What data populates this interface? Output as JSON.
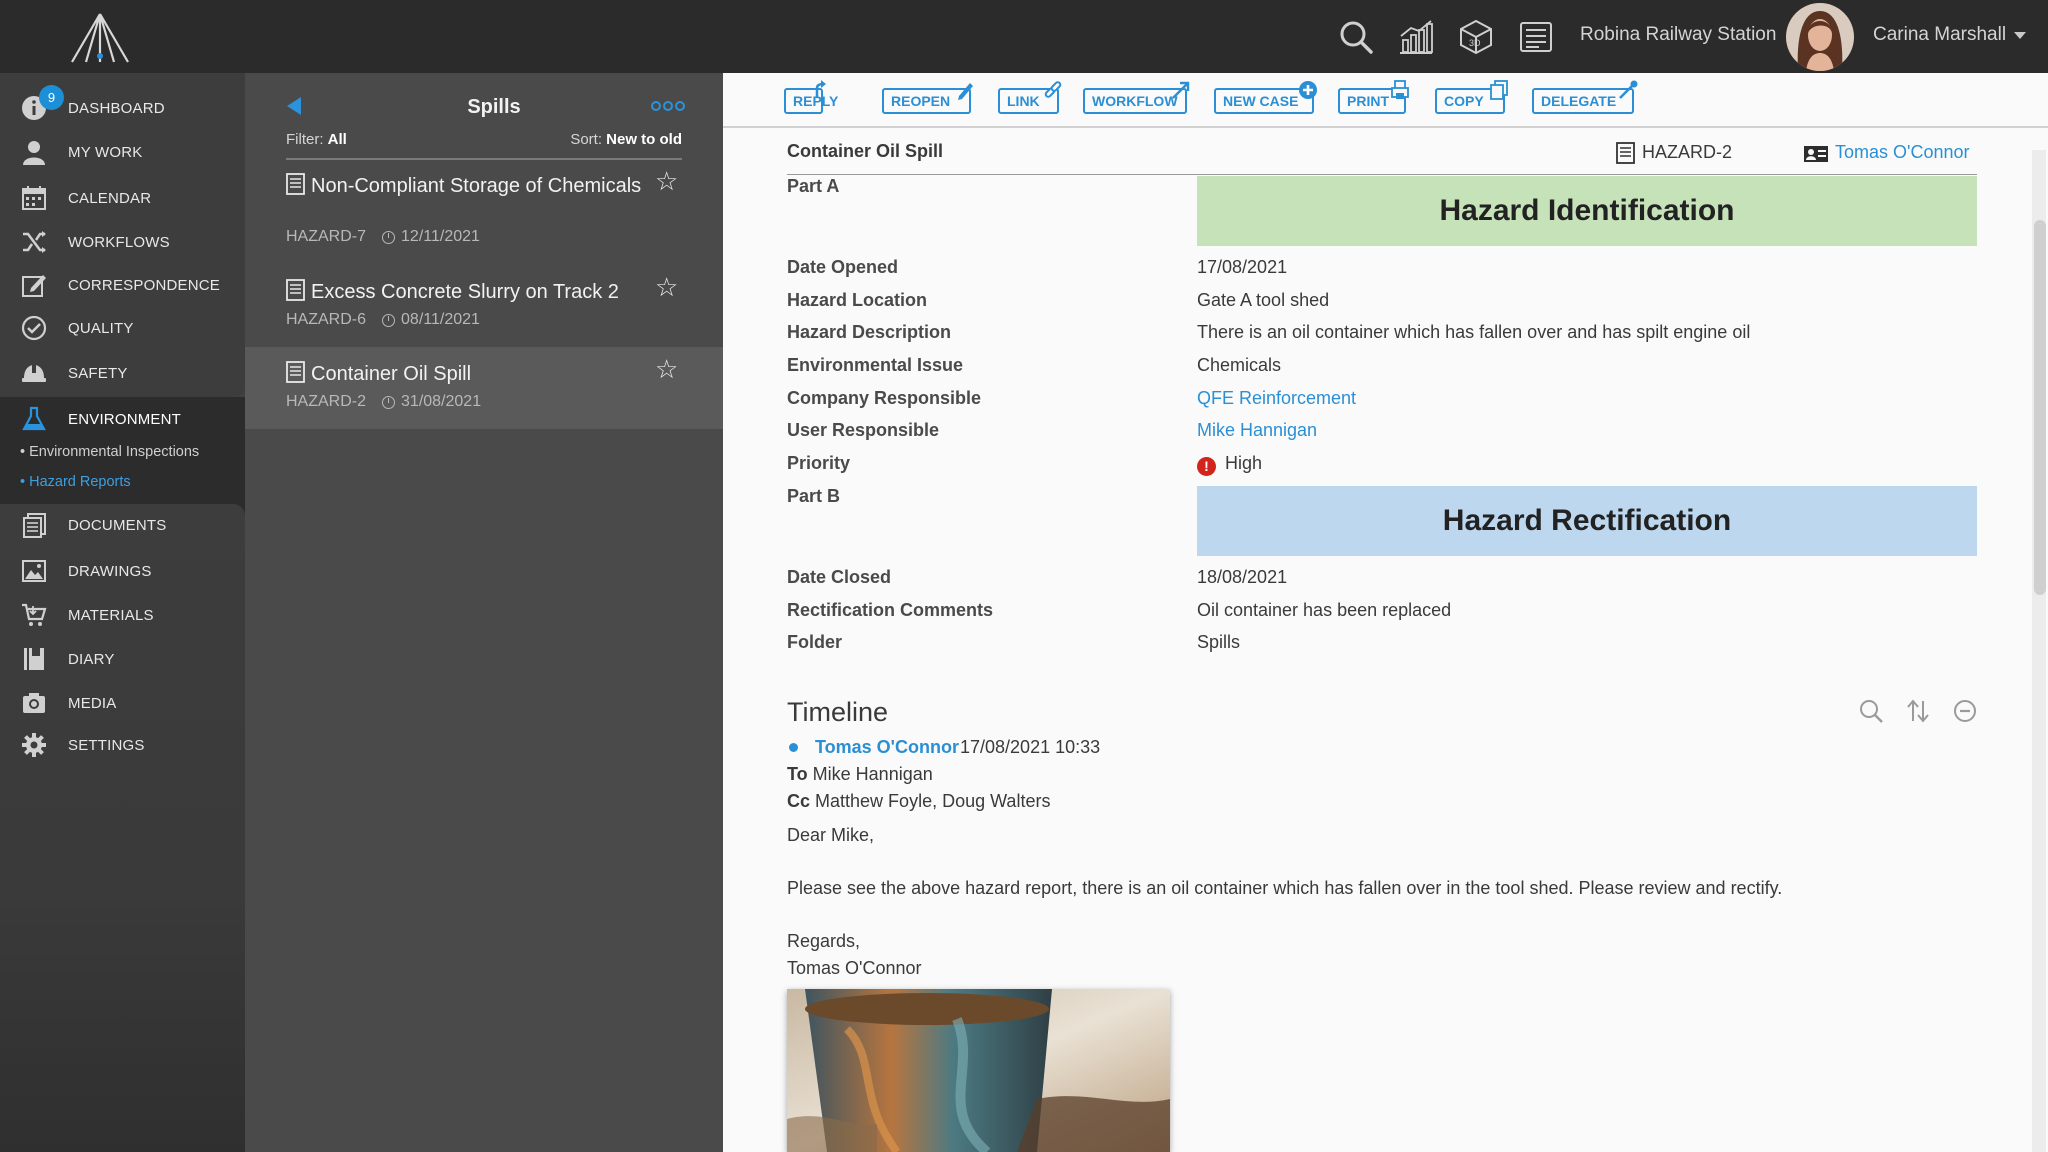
{
  "topbar": {
    "project": "Robina Railway Station",
    "user": "Carina Marshall"
  },
  "sidebar": {
    "badge_count": "9",
    "items": [
      {
        "label": "DASHBOARD"
      },
      {
        "label": "MY WORK"
      },
      {
        "label": "CALENDAR"
      },
      {
        "label": "WORKFLOWS"
      },
      {
        "label": "CORRESPONDENCE"
      },
      {
        "label": "QUALITY"
      },
      {
        "label": "SAFETY"
      },
      {
        "label": "ENVIRONMENT"
      },
      {
        "label": "DOCUMENTS"
      },
      {
        "label": "DRAWINGS"
      },
      {
        "label": "MATERIALS"
      },
      {
        "label": "DIARY"
      },
      {
        "label": "MEDIA"
      },
      {
        "label": "SETTINGS"
      }
    ],
    "subitems": [
      {
        "label": "• Environmental Inspections"
      },
      {
        "label": "• Hazard Reports"
      }
    ]
  },
  "list": {
    "title": "Spills",
    "filter_prefix": "Filter: ",
    "filter_value": "All",
    "sort_prefix": "Sort: ",
    "sort_value": "New to old",
    "items": [
      {
        "title": "Non-Compliant Storage of Chemicals",
        "id": "HAZARD-7",
        "date": "12/11/2021"
      },
      {
        "title": "Excess Concrete Slurry on Track 2",
        "id": "HAZARD-6",
        "date": "08/11/2021"
      },
      {
        "title": "Container Oil Spill",
        "id": "HAZARD-2",
        "date": "31/08/2021"
      }
    ]
  },
  "toolbar": {
    "reply": "REPLY",
    "reopen": "REOPEN",
    "link": "LINK",
    "workflow": "WORKFLOW",
    "new_case": "NEW CASE",
    "print": "PRINT",
    "copy": "COPY",
    "delegate": "DELEGATE"
  },
  "record": {
    "title": "Container Oil Spill",
    "id": "HAZARD-2",
    "owner": "Tomas O'Connor",
    "part_a_label": "Part A",
    "part_a_band": "Hazard Identification",
    "part_b_label": "Part B",
    "part_b_band": "Hazard Rectification",
    "fields_a": [
      {
        "label": "Date Opened",
        "value": "17/08/2021"
      },
      {
        "label": "Hazard Location",
        "value": "Gate A tool shed"
      },
      {
        "label": "Hazard Description",
        "value": "There is an oil container which has fallen over and has spilt engine oil"
      },
      {
        "label": "Environmental Issue",
        "value": "Chemicals"
      },
      {
        "label": "Company Responsible",
        "value": "QFE Reinforcement"
      },
      {
        "label": "User Responsible",
        "value": "Mike Hannigan"
      },
      {
        "label": "Priority",
        "value": "High"
      }
    ],
    "fields_b": [
      {
        "label": "Date Closed",
        "value": "18/08/2021"
      },
      {
        "label": "Rectification Comments",
        "value": "Oil container has been replaced"
      },
      {
        "label": "Folder",
        "value": "Spills"
      }
    ]
  },
  "timeline": {
    "title": "Timeline",
    "author": "Tomas O'Connor",
    "timestamp": "17/08/2021 10:33",
    "to_label": "To",
    "to_value": "Mike Hannigan",
    "cc_label": "Cc",
    "cc_value": "Matthew Foyle, Doug Walters",
    "greeting": "Dear Mike,",
    "body": "Please see the above hazard report, there is an oil container which has fallen over in the tool shed. Please review and rectify.",
    "signoff": "Regards,",
    "signature": "Tomas O'Connor"
  },
  "colors": {
    "accent": "#2a8fd4",
    "topbar": "#2b2b2b",
    "sidebar": "#3d3d3d",
    "list_panel": "#4a4a4a",
    "band_identification": "#c6e2b8",
    "band_rectification": "#bcd7ee",
    "priority_high": "#d0241d"
  },
  "icons": {
    "topbar": [
      "search-icon",
      "bar-chart-icon",
      "3d-cube-icon",
      "list-icon"
    ],
    "sidebar": [
      "info-icon",
      "user-icon",
      "calendar-icon",
      "shuffle-icon",
      "edit-icon",
      "check-circle-icon",
      "hard-hat-icon",
      "flask-icon",
      "documents-icon",
      "image-icon",
      "cart-icon",
      "book-icon",
      "camera-icon",
      "gear-icon"
    ],
    "timeline_tools": [
      "search-icon",
      "sort-icon",
      "collapse-icon"
    ]
  }
}
